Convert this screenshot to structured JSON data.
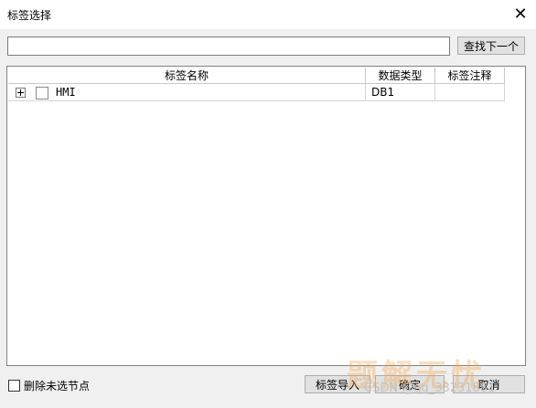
{
  "window": {
    "title": "标签选择",
    "close_symbol": "✕"
  },
  "search": {
    "value": "",
    "placeholder": "",
    "find_next_label": "查找下一个"
  },
  "table": {
    "columns": [
      "标签名称",
      "数据类型",
      "标签注释"
    ],
    "rows": [
      {
        "name": "HMI",
        "type": "DB1",
        "comment": "",
        "checked": false,
        "expanded": false
      }
    ]
  },
  "footer": {
    "delete_unselected_label": "删除未选节点",
    "import_label": "标签导入",
    "ok_label": "确定",
    "cancel_label": "取消"
  },
  "watermark": {
    "text": "CSDN @qq_33231881",
    "overlay": "题解无忧"
  }
}
